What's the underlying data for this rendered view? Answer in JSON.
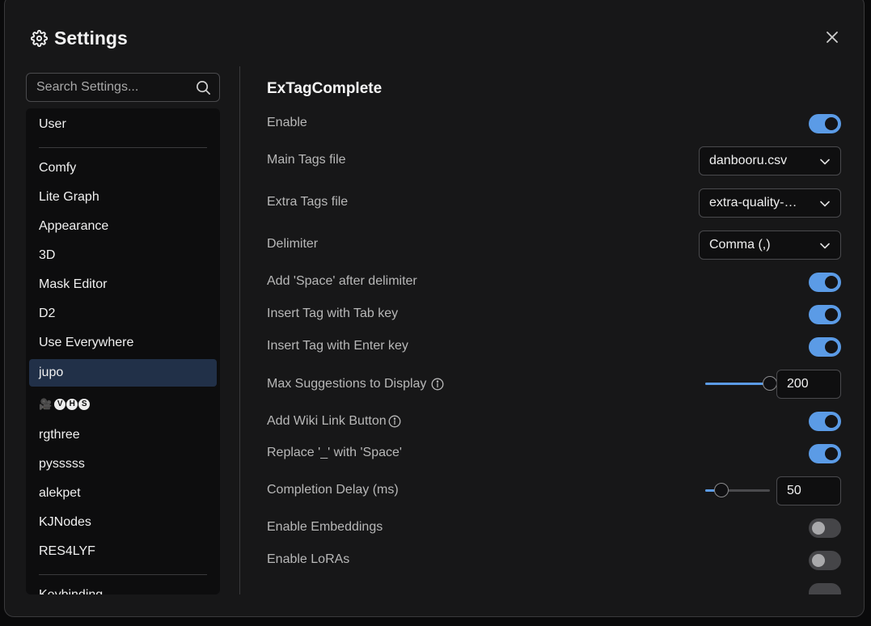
{
  "dialog": {
    "title": "Settings",
    "close_icon": "close-icon",
    "title_icon": "gear-icon"
  },
  "search": {
    "placeholder": "Search Settings...",
    "value": ""
  },
  "sidebar": {
    "items": [
      {
        "label": "User",
        "active": false
      },
      {
        "label": "Comfy",
        "active": false
      },
      {
        "label": "Lite Graph",
        "active": false
      },
      {
        "label": "Appearance",
        "active": false
      },
      {
        "label": "3D",
        "active": false
      },
      {
        "label": "Mask Editor",
        "active": false
      },
      {
        "label": "D2",
        "active": false
      },
      {
        "label": "Use Everywhere",
        "active": false
      },
      {
        "label": "jupo",
        "active": true
      },
      {
        "label": "🎥 V H S",
        "active": false,
        "emoji": "🎥",
        "badges": [
          "V",
          "H",
          "S"
        ]
      },
      {
        "label": "rgthree",
        "active": false
      },
      {
        "label": "pysssss",
        "active": false
      },
      {
        "label": "alekpet",
        "active": false
      },
      {
        "label": "KJNodes",
        "active": false
      },
      {
        "label": "RES4LYF",
        "active": false
      },
      {
        "label": "Keybinding",
        "active": false
      }
    ]
  },
  "main": {
    "section_title": "ExTagComplete",
    "settings": {
      "enable": {
        "label": "Enable",
        "value": true
      },
      "main_tags_file": {
        "label": "Main Tags file",
        "value": "danbooru.csv"
      },
      "extra_tags_file": {
        "label": "Extra Tags file",
        "value": "extra-quality-tags.csv",
        "shown": "extra-quality-…"
      },
      "delimiter": {
        "label": "Delimiter",
        "value": "Comma (,)"
      },
      "add_space": {
        "label": "Add 'Space' after delimiter",
        "value": true
      },
      "insert_tab": {
        "label": "Insert Tag with Tab key",
        "value": true
      },
      "insert_enter": {
        "label": "Insert Tag with Enter key",
        "value": true
      },
      "max_suggestions": {
        "label": "Max Suggestions to Display",
        "value": "200",
        "slider_fraction": 1.0
      },
      "wiki_link": {
        "label": "Add Wiki Link Button",
        "value": true
      },
      "replace_underscore": {
        "label": "Replace '_' with 'Space'",
        "value": true
      },
      "completion_delay": {
        "label": "Completion Delay (ms)",
        "value": "50",
        "slider_fraction": 0.25
      },
      "enable_embeddings": {
        "label": "Enable Embeddings",
        "value": false
      },
      "enable_loras": {
        "label": "Enable LoRAs",
        "value": false
      }
    }
  },
  "colors": {
    "accent": "#5b9be6",
    "active_nav": "#213048",
    "dialog_bg": "#171718"
  }
}
